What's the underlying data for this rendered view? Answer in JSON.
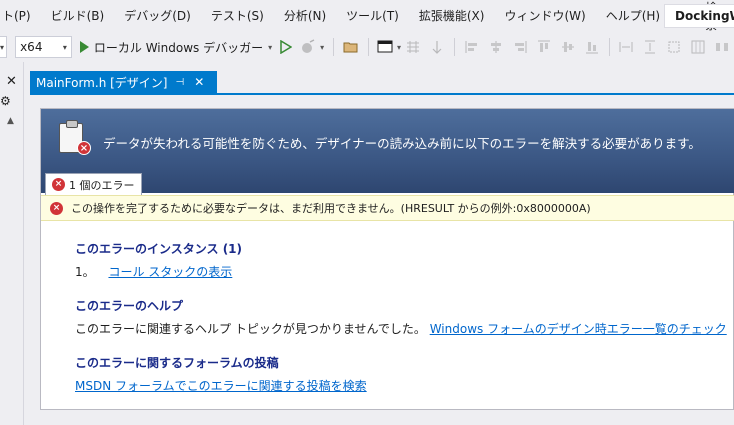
{
  "menu": {
    "items": [
      "ト(P)",
      "ビルド(B)",
      "デバッグ(D)",
      "テスト(S)",
      "分析(N)",
      "ツール(T)",
      "拡張機能(X)",
      "ウィンドウ(W)",
      "ヘルプ(H)"
    ],
    "search_label": "検索",
    "title": "DockingW"
  },
  "toolbar": {
    "platform_value": "x64",
    "run_label": "ローカル Windows デバッガー"
  },
  "leftstrip": {
    "close_glyph": "✕"
  },
  "document": {
    "tab_label": "MainForm.h [デザイン]",
    "tab_pin": "⊣",
    "tab_close": "✕"
  },
  "designer_error": {
    "header_message": "データが失われる可能性を防ぐため、デザイナーの読み込み前に以下のエラーを解決する必要があります。",
    "error_tab_label": "1 個のエラー",
    "error_message": "この操作を完了するために必要なデータは、まだ利用できません。(HRESULT からの例外:0x8000000A)",
    "instances": {
      "title": "このエラーのインスタンス (1)",
      "number": "1。",
      "link": "コール スタックの表示"
    },
    "help": {
      "title": "このエラーのヘルプ",
      "text": "このエラーに関連するヘルプ トピックが見つかりませんでした。",
      "link": "Windows フォームのデザイン時エラー一覧のチェック"
    },
    "forum": {
      "title": "このエラーに関するフォーラムの投稿",
      "link": "MSDN フォーラムでこのエラーに関連する投稿を検索"
    }
  },
  "colors": {
    "accent": "#007acc",
    "header_top": "#4e6e9c",
    "header_bottom": "#2e4670",
    "error_red": "#d13438",
    "banner_bg": "#fefde1",
    "link": "#0066cc",
    "section_title": "#1a2b8a"
  },
  "icons": [
    "search-icon",
    "play-icon",
    "play-outline-icon",
    "attach-icon",
    "folder-icon",
    "window-icon",
    "align-icons",
    "clipboard-error-icon",
    "error-icon",
    "pin-icon",
    "close-icon",
    "gear-icon"
  ]
}
